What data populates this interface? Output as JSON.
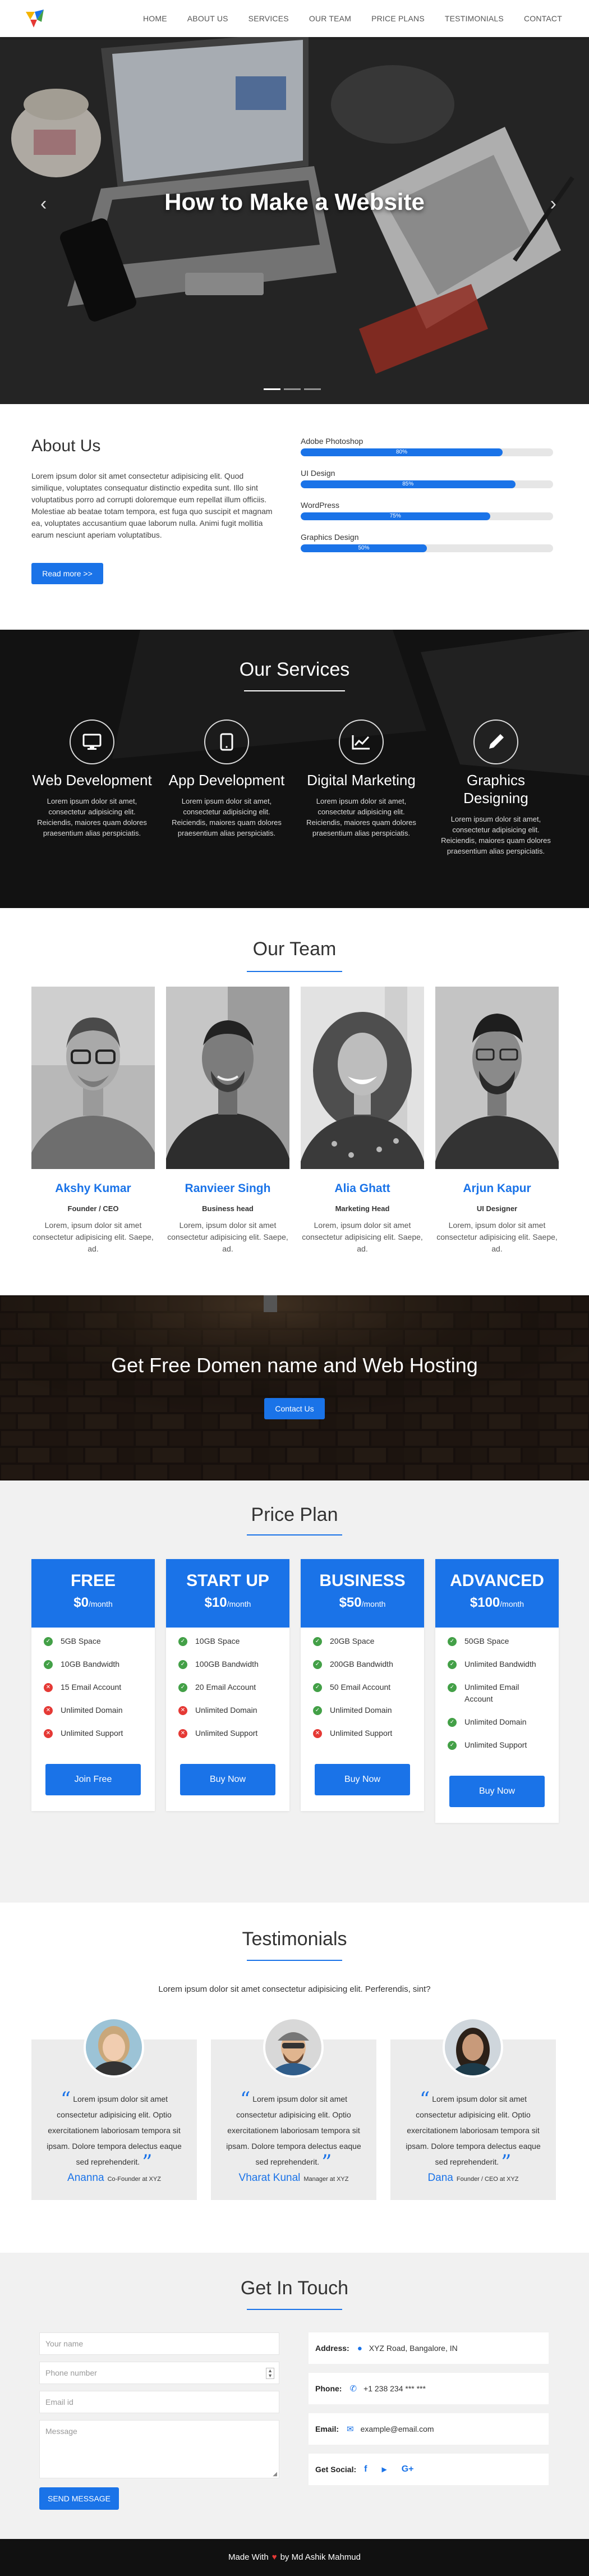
{
  "nav": {
    "items": [
      "HOME",
      "ABOUT US",
      "SERVICES",
      "OUR TEAM",
      "PRICE PLANS",
      "TESTIMONIALS",
      "CONTACT"
    ]
  },
  "hero": {
    "title": "How to Make a Website",
    "prev": "‹",
    "next": "›",
    "active_slide": 1
  },
  "about": {
    "title": "About Us",
    "text": "Lorem ipsum dolor sit amet consectetur adipisicing elit. Quod similique, voluptates consequatur distinctio expedita sunt. Illo sint voluptatibus porro ad corrupti doloremque eum repellat illum officiis. Molestiae ab beatae totam tempora, est fuga quo suscipit et magnam ea, voluptates accusantium quae laborum nulla. Animi fugit mollitia earum nesciunt aperiam voluptatibus.",
    "button": "Read more >>",
    "skills": [
      {
        "name": "Adobe Photoshop",
        "value": 80,
        "label": "80%"
      },
      {
        "name": "UI Design",
        "value": 85,
        "label": "85%"
      },
      {
        "name": "WordPress",
        "value": 75,
        "label": "75%"
      },
      {
        "name": "Graphics Design",
        "value": 50,
        "label": "50%"
      }
    ]
  },
  "services": {
    "title": "Our Services",
    "items": [
      {
        "icon": "monitor-icon",
        "title": "Web Development",
        "text": "Lorem ipsum dolor sit amet, consectetur adipisicing elit. Reiciendis, maiores quam dolores praesentium alias perspiciatis."
      },
      {
        "icon": "tablet-icon",
        "title": "App Development",
        "text": "Lorem ipsum dolor sit amet, consectetur adipisicing elit. Reiciendis, maiores quam dolores praesentium alias perspiciatis."
      },
      {
        "icon": "chart-line-icon",
        "title": "Digital Marketing",
        "text": "Lorem ipsum dolor sit amet, consectetur adipisicing elit. Reiciendis, maiores quam dolores praesentium alias perspiciatis."
      },
      {
        "icon": "pen-icon",
        "title": "Graphics Designing",
        "text": "Lorem ipsum dolor sit amet, consectetur adipisicing elit. Reiciendis, maiores quam dolores praesentium alias perspiciatis."
      }
    ]
  },
  "team": {
    "title": "Our Team",
    "members": [
      {
        "name": "Akshy Kumar",
        "role": "Founder / CEO",
        "text": "Lorem, ipsum dolor sit amet consectetur adipisicing elit. Saepe, ad."
      },
      {
        "name": "Ranvieer Singh",
        "role": "Business head",
        "text": "Lorem, ipsum dolor sit amet consectetur adipisicing elit. Saepe, ad."
      },
      {
        "name": "Alia Ghatt",
        "role": "Marketing Head",
        "text": "Lorem, ipsum dolor sit amet consectetur adipisicing elit. Saepe, ad."
      },
      {
        "name": "Arjun Kapur",
        "role": "UI Designer",
        "text": "Lorem, ipsum dolor sit amet consectetur adipisicing elit. Saepe, ad."
      }
    ]
  },
  "cta": {
    "title": "Get Free Domen name and Web Hosting",
    "button": "Contact Us"
  },
  "pricing": {
    "title": "Price Plan",
    "per": "/month",
    "plans": [
      {
        "name": "FREE",
        "price": "$0",
        "features": [
          {
            "t": "5GB Space",
            "ok": true
          },
          {
            "t": "10GB Bandwidth",
            "ok": true
          },
          {
            "t": "15 Email Account",
            "ok": false
          },
          {
            "t": "Unlimited Domain",
            "ok": false
          },
          {
            "t": "Unlimited Support",
            "ok": false
          }
        ],
        "button": "Join Free"
      },
      {
        "name": "START UP",
        "price": "$10",
        "features": [
          {
            "t": "10GB Space",
            "ok": true
          },
          {
            "t": "100GB Bandwidth",
            "ok": true
          },
          {
            "t": "20 Email Account",
            "ok": true
          },
          {
            "t": "Unlimited Domain",
            "ok": false
          },
          {
            "t": "Unlimited Support",
            "ok": false
          }
        ],
        "button": "Buy Now"
      },
      {
        "name": "BUSINESS",
        "price": "$50",
        "features": [
          {
            "t": "20GB Space",
            "ok": true
          },
          {
            "t": "200GB Bandwidth",
            "ok": true
          },
          {
            "t": "50 Email Account",
            "ok": true
          },
          {
            "t": "Unlimited Domain",
            "ok": true
          },
          {
            "t": "Unlimited Support",
            "ok": false
          }
        ],
        "button": "Buy Now"
      },
      {
        "name": "ADVANCED",
        "price": "$100",
        "features": [
          {
            "t": "50GB Space",
            "ok": true
          },
          {
            "t": "Unlimited Bandwidth",
            "ok": true
          },
          {
            "t": "Unlimited Email Account",
            "ok": true
          },
          {
            "t": "Unlimited Domain",
            "ok": true
          },
          {
            "t": "Unlimited Support",
            "ok": true
          }
        ],
        "button": "Buy Now"
      }
    ]
  },
  "testimonials": {
    "title": "Testimonials",
    "intro": "Lorem ipsum dolor sit amet consectetur adipisicing elit. Perferendis, sint?",
    "items": [
      {
        "text": "Lorem ipsum dolor sit amet consectetur adipisicing elit. Optio exercitationem laboriosam tempora sit ipsam. Dolore tempora delectus eaque sed reprehenderit.",
        "name": "Ananna",
        "role": "Co-Founder at XYZ"
      },
      {
        "text": "Lorem ipsum dolor sit amet consectetur adipisicing elit. Optio exercitationem laboriosam tempora sit ipsam. Dolore tempora delectus eaque sed reprehenderit.",
        "name": "Vharat Kunal",
        "role": "Manager at XYZ"
      },
      {
        "text": "Lorem ipsum dolor sit amet consectetur adipisicing elit. Optio exercitationem laboriosam tempora sit ipsam. Dolore tempora delectus eaque sed reprehenderit.",
        "name": "Dana",
        "role": "Founder / CEO at XYZ"
      }
    ]
  },
  "contact": {
    "title": "Get In Touch",
    "name_ph": "Your name",
    "phone_ph": "Phone number",
    "email_ph": "Email id",
    "message_ph": "Message",
    "send": "SEND MESSAGE",
    "address_label": "Address:",
    "address": "XYZ Road, Bangalore, IN",
    "phone_label": "Phone:",
    "phone": "+1 238 234 *** ***",
    "email_label": "Email:",
    "email": "example@email.com",
    "social_label": "Get Social:",
    "social": [
      "f",
      "▶",
      "G+"
    ]
  },
  "footer": {
    "made": "Made With",
    "by": "by Md Ashik Mahmud"
  },
  "colors": {
    "accent": "#1a73e8",
    "danger": "#e53935",
    "success": "#43a047"
  }
}
